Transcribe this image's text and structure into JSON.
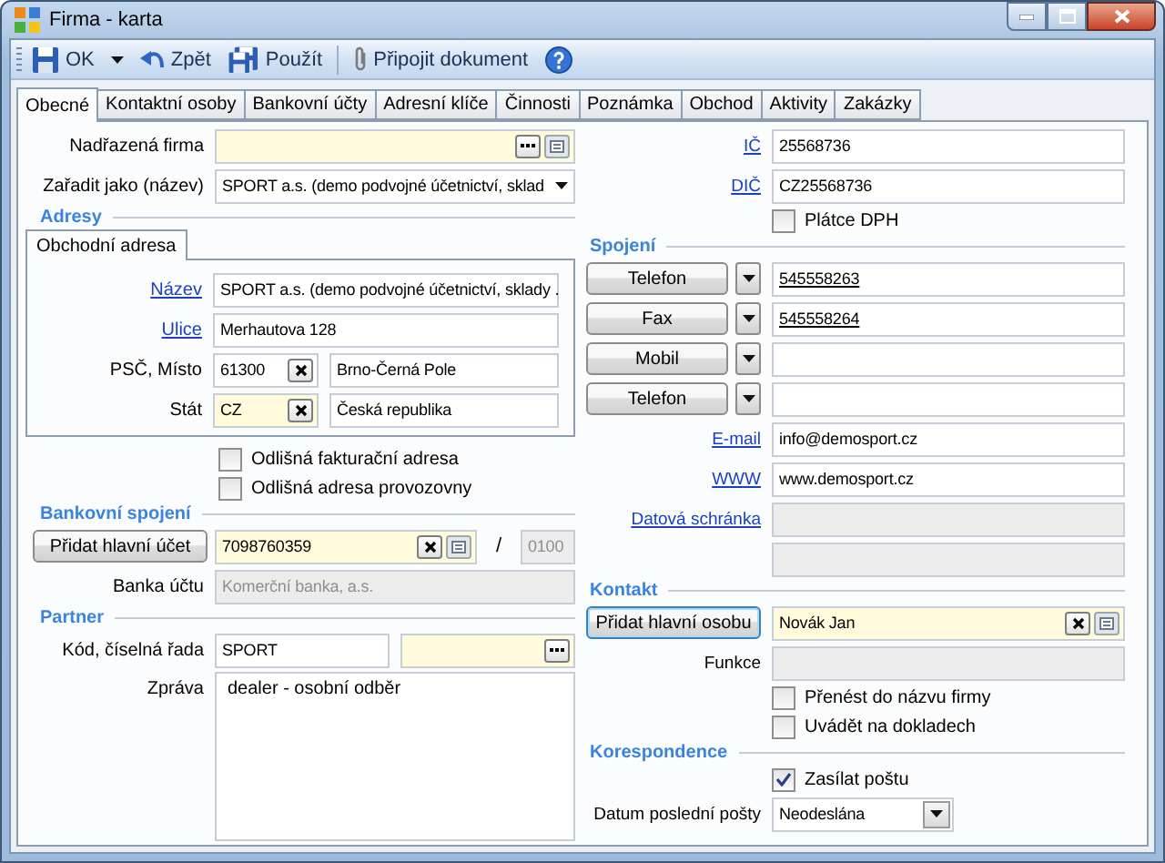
{
  "window": {
    "title": "Firma - karta"
  },
  "toolbar": [
    {
      "kind": "ok",
      "label": "OK",
      "menu": true
    },
    {
      "kind": "back",
      "label": "Zpět"
    },
    {
      "kind": "apply",
      "label": "Použít"
    },
    {
      "kind": "separator"
    },
    {
      "kind": "attach",
      "label": "Připojit dokument"
    },
    {
      "kind": "help"
    }
  ],
  "tabs": [
    {
      "label": "Obecné",
      "selected": true
    },
    {
      "label": "Kontaktní osoby",
      "selected": false
    },
    {
      "label": "Bankovní účty",
      "selected": false
    },
    {
      "label": "Adresní klíče",
      "selected": false
    },
    {
      "label": "Činnosti",
      "selected": false
    },
    {
      "label": "Poznámka",
      "selected": false
    },
    {
      "label": "Obchod",
      "selected": false
    },
    {
      "label": "Aktivity",
      "selected": false
    },
    {
      "label": "Zakázky",
      "selected": false
    }
  ],
  "left": [
    {
      "kind": "field",
      "label": "Nadřazená firma",
      "inputs": [
        {
          "required": true,
          "more_button": true,
          "list_button": true
        }
      ]
    },
    {
      "kind": "select",
      "label": "Zařadit jako (název)",
      "value": "SPORT a.s. (demo podvojné účetnictví, sklad"
    },
    {
      "kind": "section",
      "title": "Adresy"
    },
    {
      "kind": "address",
      "tabs": [
        {
          "label": "Obchodní adresa",
          "selected": true
        }
      ],
      "rows": [
        {
          "kind": "field",
          "label": "Název",
          "link": true,
          "inputs": [
            {
              "value": "SPORT a.s. (demo podvojné účetnictví, sklady ."
            }
          ]
        },
        {
          "kind": "field",
          "label": "Ulice",
          "link": true,
          "inputs": [
            {
              "value": "Merhautova 128"
            }
          ]
        },
        {
          "kind": "pair",
          "label": "PSČ, Místo",
          "inputs": [
            {
              "value": "61300",
              "clear_button": true
            },
            {
              "value": "Brno-Černá Pole"
            }
          ]
        },
        {
          "kind": "pair",
          "label": "Stát",
          "inputs": [
            {
              "value": "CZ",
              "required": true,
              "clear_button": true
            },
            {
              "value": "Česká republika"
            }
          ]
        }
      ]
    },
    {
      "kind": "checkbox",
      "label": "Odlišná fakturační adresa",
      "checked": false
    },
    {
      "kind": "checkbox",
      "label": "Odlišná adresa provozovny",
      "checked": false
    },
    {
      "kind": "section",
      "title": "Bankovní spojení"
    },
    {
      "kind": "account",
      "button": "Přidat hlavní účet",
      "separator": "/",
      "inputs": [
        {
          "value": "7098760359",
          "required": true,
          "clear_button": true,
          "list_button": true
        },
        {
          "value": "0100",
          "disabled": true
        }
      ]
    },
    {
      "kind": "field",
      "label": "Banka účtu",
      "inputs": [
        {
          "value": "Komerční banka, a.s.",
          "disabled": true
        }
      ]
    },
    {
      "kind": "section",
      "title": "Partner"
    },
    {
      "kind": "half",
      "label": "Kód, číselná řada",
      "inputs": [
        {
          "value": "SPORT"
        },
        {
          "required": true,
          "more_button": true
        }
      ]
    },
    {
      "kind": "memo",
      "label": "Zpráva",
      "value": "dealer - osobní odběr"
    }
  ],
  "right": [
    {
      "kind": "field",
      "label": "IČ",
      "link": true,
      "inputs": [
        {
          "value": "25568736"
        }
      ]
    },
    {
      "kind": "field",
      "label": "DIČ",
      "link": true,
      "inputs": [
        {
          "value": "CZ25568736"
        }
      ]
    },
    {
      "kind": "checkbox",
      "label": "Plátce DPH",
      "checked": false
    },
    {
      "kind": "section",
      "title": "Spojení"
    },
    {
      "kind": "phone",
      "button": "Telefon",
      "value": "545558263"
    },
    {
      "kind": "phone",
      "button": "Fax",
      "value": "545558264"
    },
    {
      "kind": "phone",
      "button": "Mobil"
    },
    {
      "kind": "phone",
      "button": "Telefon"
    },
    {
      "kind": "field",
      "label": "E-mail",
      "link": true,
      "inputs": [
        {
          "value": "info@demosport.cz"
        }
      ]
    },
    {
      "kind": "field",
      "label": "WWW",
      "link": true,
      "inputs": [
        {
          "value": "www.demosport.cz"
        }
      ]
    },
    {
      "kind": "field",
      "label": "Datová schránka",
      "link": true,
      "inputs": [
        {
          "disabled": true
        }
      ]
    },
    {
      "kind": "field",
      "inputs": [
        {
          "disabled": true
        }
      ]
    },
    {
      "kind": "section",
      "title": "Kontakt"
    },
    {
      "kind": "button_field",
      "button": "Přidat hlavní osobu",
      "focused": true,
      "inputs": [
        {
          "value": "Novák Jan",
          "required": true,
          "clear_button": true,
          "list_button": true
        }
      ]
    },
    {
      "kind": "field",
      "label": "Funkce",
      "inputs": [
        {
          "disabled": true
        }
      ]
    },
    {
      "kind": "checkbox",
      "label": "Přenést do názvu firmy",
      "checked": false
    },
    {
      "kind": "checkbox",
      "label": "Uvádět na dokladech",
      "checked": false
    },
    {
      "kind": "section",
      "title": "Korespondence"
    },
    {
      "kind": "checkbox",
      "label": "Zasílat poštu",
      "checked": true
    },
    {
      "kind": "select",
      "label": "Datum poslední pošty",
      "value": "Neodeslána"
    }
  ]
}
